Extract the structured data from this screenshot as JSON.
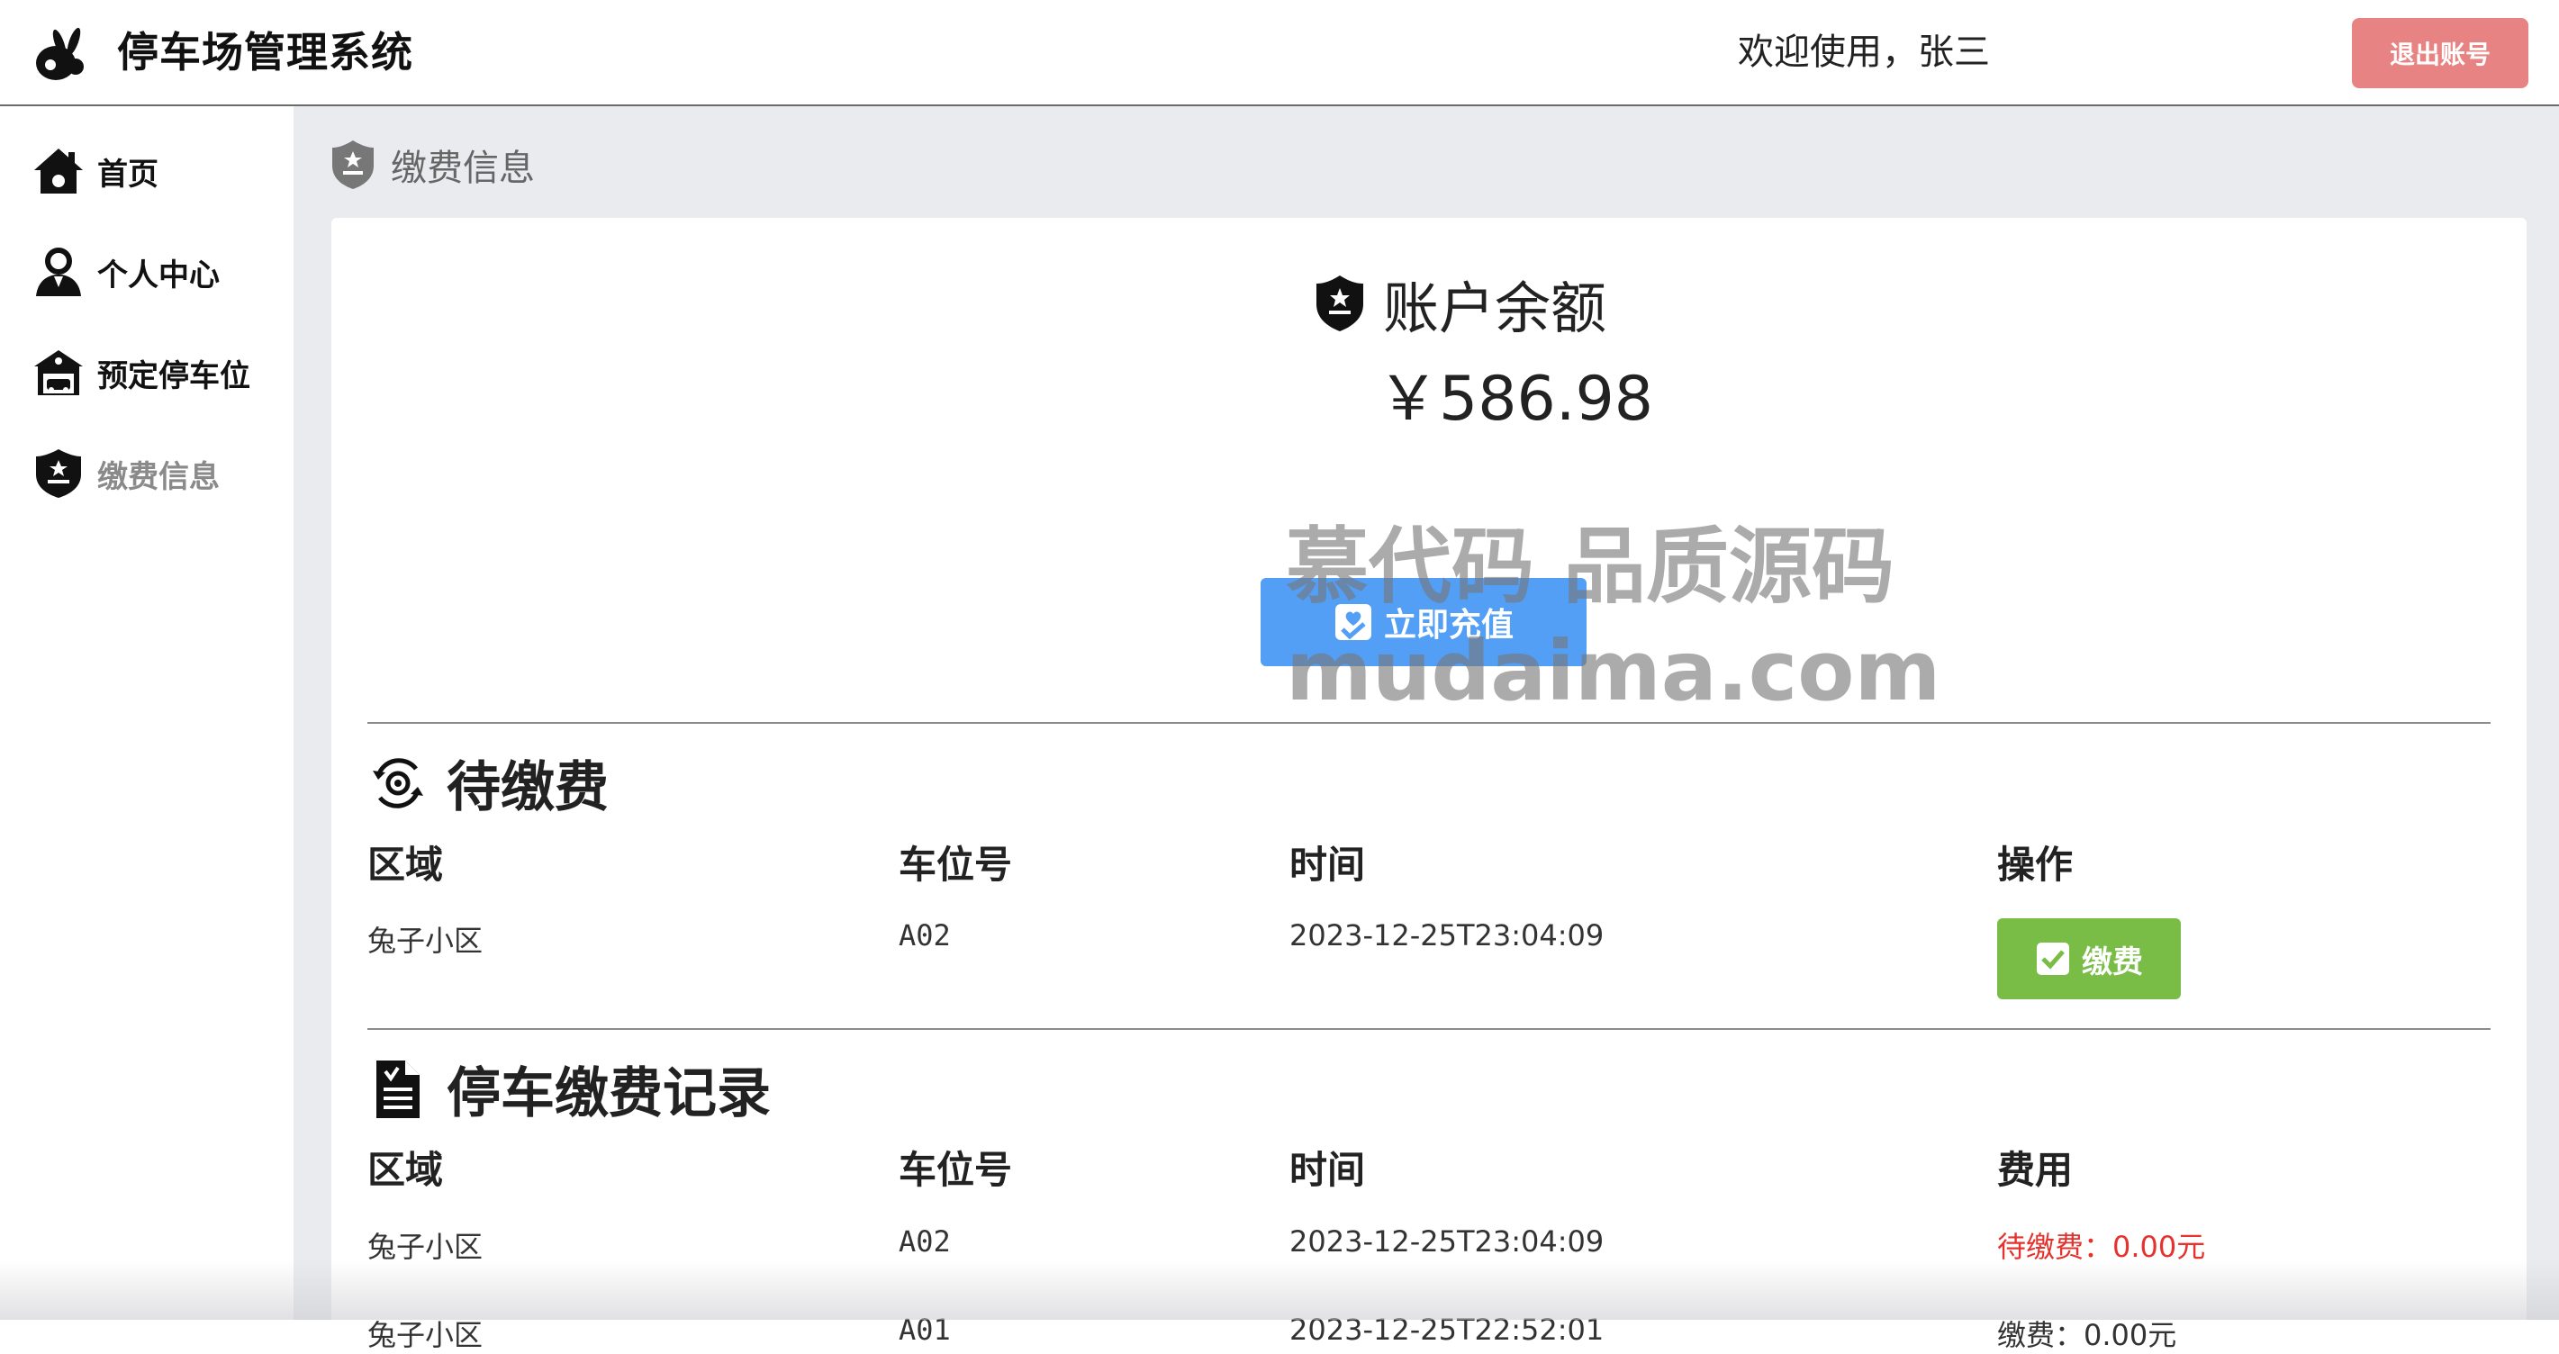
{
  "header": {
    "app_title": "停车场管理系统",
    "welcome_text": "欢迎使用，张三",
    "logout_label": "退出账号"
  },
  "sidebar": {
    "items": [
      {
        "label": "首页",
        "icon": "home-icon"
      },
      {
        "label": "个人中心",
        "icon": "user-icon"
      },
      {
        "label": "预定停车位",
        "icon": "parking-house-icon"
      },
      {
        "label": "缴费信息",
        "icon": "shield-badge-icon",
        "active": true
      }
    ]
  },
  "page": {
    "title": "缴费信息"
  },
  "balance": {
    "title": "账户余额",
    "amount": "￥586.98",
    "recharge_label": "立即充值"
  },
  "pending": {
    "title": "待缴费",
    "headers": [
      "区域",
      "车位号",
      "时间",
      "操作"
    ],
    "rows": [
      {
        "area": "兔子小区",
        "spot": "A02",
        "time": "2023-12-25T23:04:09",
        "action": "缴费"
      }
    ]
  },
  "records": {
    "title": "停车缴费记录",
    "headers": [
      "区域",
      "车位号",
      "时间",
      "费用"
    ],
    "rows": [
      {
        "area": "兔子小区",
        "spot": "A02",
        "time": "2023-12-25T23:04:09",
        "fee": "待缴费：0.00元",
        "fee_status": "pending"
      },
      {
        "area": "兔子小区",
        "spot": "A01",
        "time": "2023-12-25T22:52:01",
        "fee": "缴费：0.00元",
        "fee_status": "paid"
      }
    ]
  },
  "watermark": {
    "line1": "慕代码 品质源码",
    "line2": "mudaima.com"
  },
  "colors": {
    "logout": "#e88383",
    "recharge": "#539ff6",
    "pay": "#79bd47",
    "pending_text": "#e5322d",
    "main_bg": "#e9ebef"
  }
}
